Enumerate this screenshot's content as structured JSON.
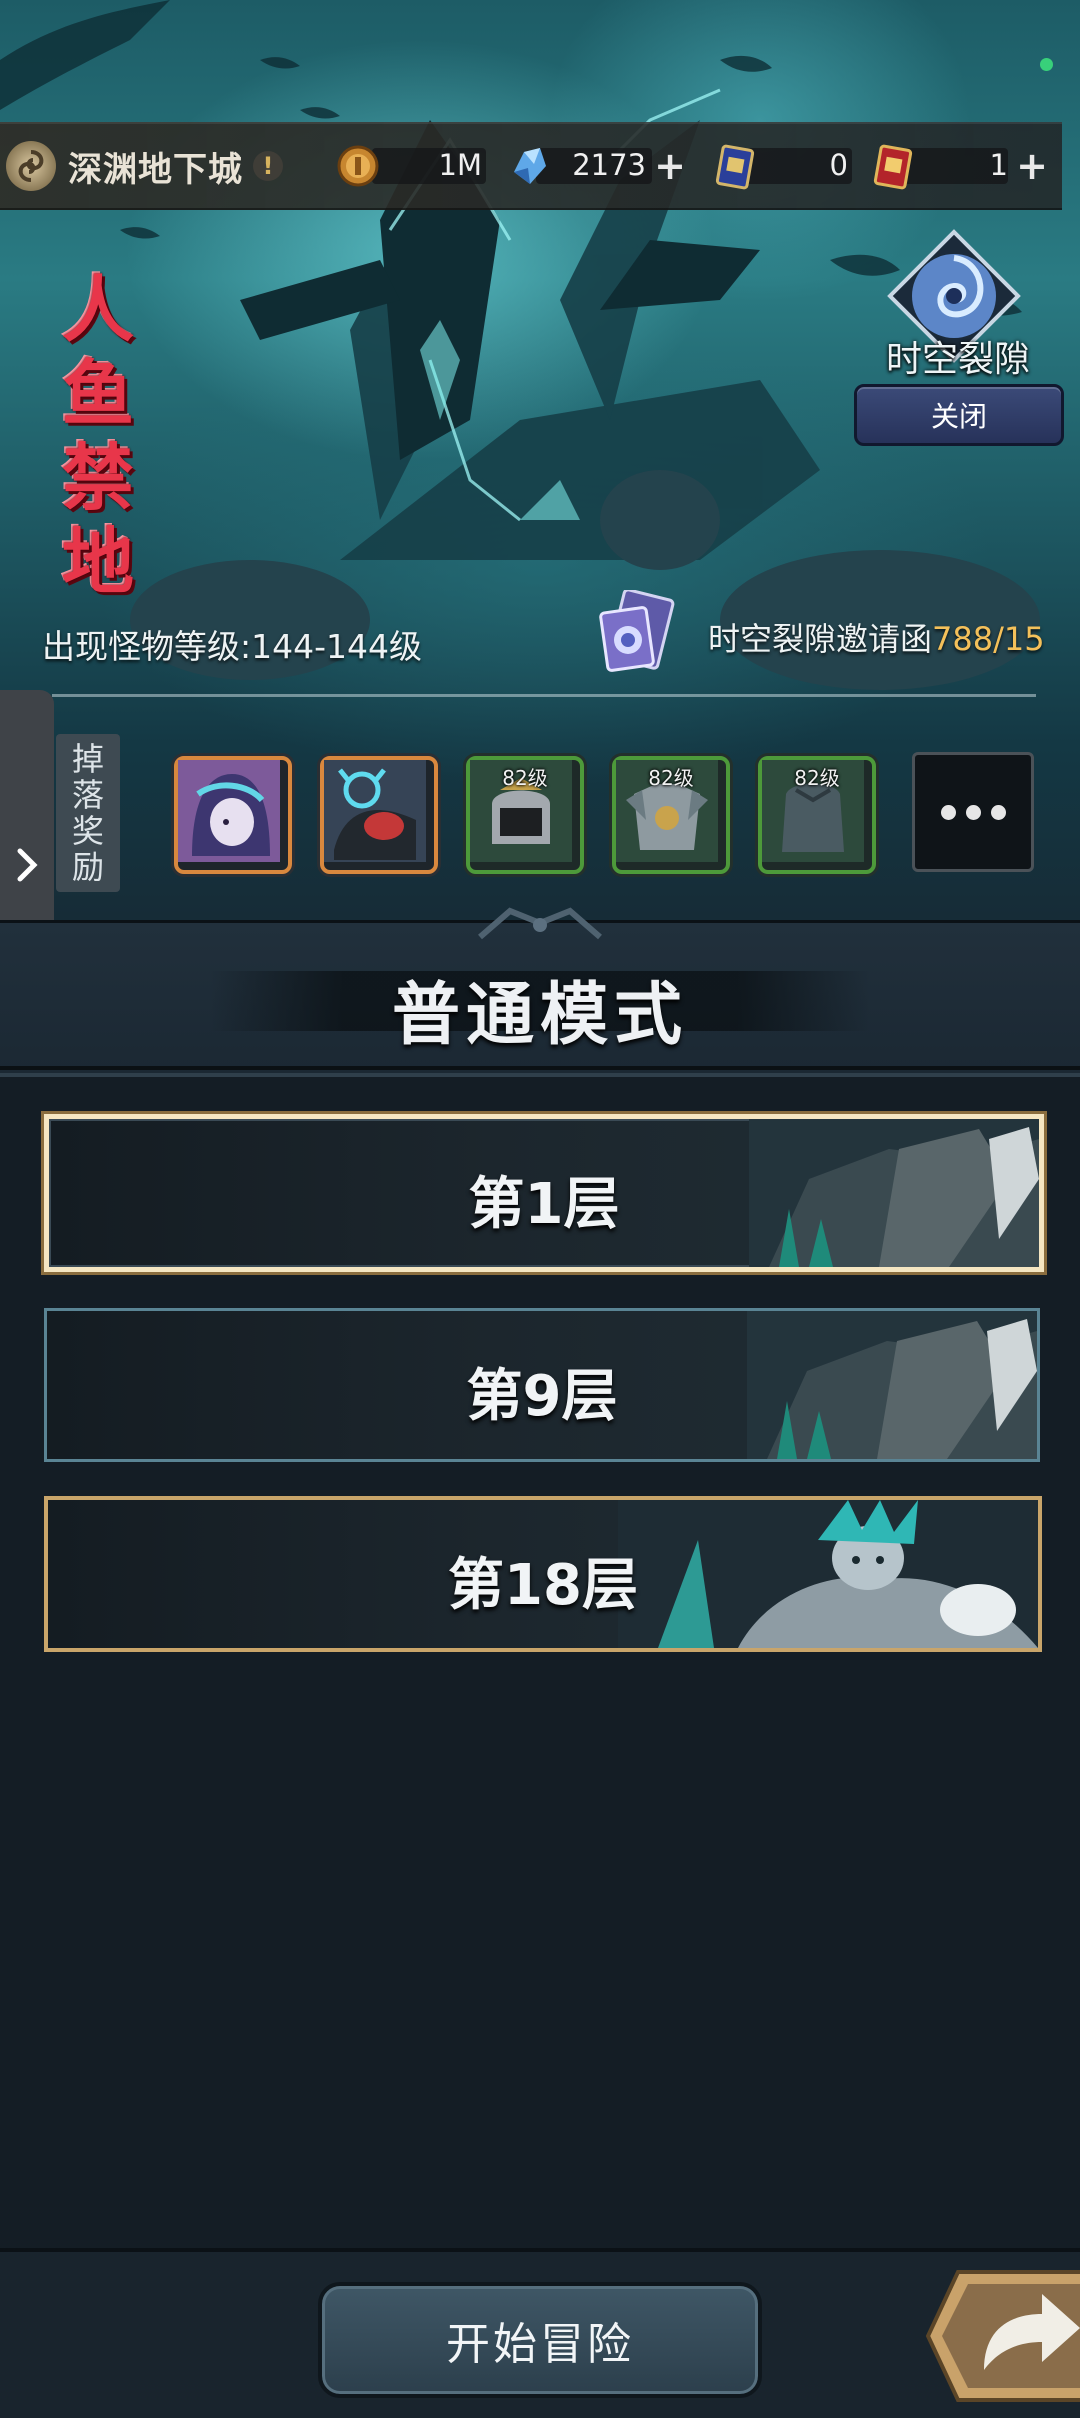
{
  "header": {
    "dungeon_name": "深渊地下城",
    "info_icon": "!",
    "resources": [
      {
        "name": "gold-coin-icon",
        "value": "1M",
        "has_plus": false
      },
      {
        "name": "crystal-icon",
        "value": "2173",
        "has_plus": true
      },
      {
        "name": "blue-ticket-icon",
        "value": "0",
        "has_plus": false
      },
      {
        "name": "red-ticket-icon",
        "value": "1",
        "has_plus": true
      }
    ]
  },
  "logo": {
    "chars": [
      "人",
      "鱼",
      "禁",
      "地"
    ]
  },
  "rift": {
    "label": "时空裂隙",
    "close_label": "关闭"
  },
  "monster_level": "出现怪物等级:144-144级",
  "invite": {
    "label": "时空裂隙邀请函",
    "count": "788/15"
  },
  "drop": {
    "label_chars": [
      "掉",
      "落",
      "奖",
      "励"
    ],
    "items": [
      {
        "level": "",
        "frame": "orange"
      },
      {
        "level": "",
        "frame": "orange"
      },
      {
        "level": "82级",
        "frame": "green"
      },
      {
        "level": "82级",
        "frame": "green"
      },
      {
        "level": "82级",
        "frame": "green"
      }
    ]
  },
  "mode": {
    "title": "普通模式"
  },
  "floors": [
    {
      "label": "第1层",
      "selected": true
    },
    {
      "label": "第9层",
      "selected": false
    },
    {
      "label": "第18层",
      "selected": false
    }
  ],
  "footer": {
    "start_label": "开始冒险"
  },
  "colors": {
    "accent_gold": "#f4c05a",
    "background": "#141d25",
    "frame_green": "#4d9a3a",
    "frame_orange": "#d9883e"
  }
}
